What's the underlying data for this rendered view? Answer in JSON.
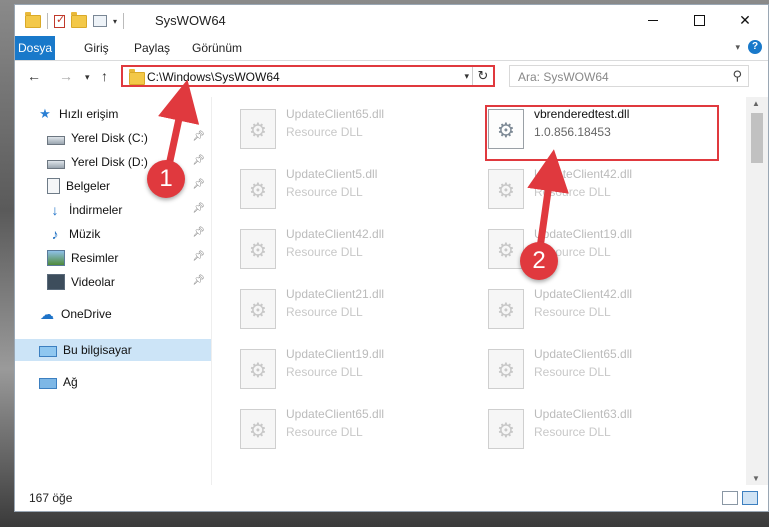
{
  "window": {
    "title": "SysWOW64"
  },
  "ribbon": {
    "tabs": [
      {
        "label": "Dosya",
        "active": true
      },
      {
        "label": "Giriş"
      },
      {
        "label": "Paylaş"
      },
      {
        "label": "Görünüm"
      }
    ]
  },
  "address": {
    "path": "C:\\Windows\\SysWOW64"
  },
  "search": {
    "placeholder": "Ara: SysWOW64"
  },
  "sidebar": {
    "items": [
      {
        "label": "Hızlı erişim",
        "icon": "star-icon"
      },
      {
        "label": "Yerel Disk (C:)",
        "icon": "disk-icon",
        "pinned": true
      },
      {
        "label": "Yerel Disk (D:)",
        "icon": "disk-icon",
        "pinned": true
      },
      {
        "label": "Belgeler",
        "icon": "document-icon",
        "pinned": true
      },
      {
        "label": "İndirmeler",
        "icon": "download-icon",
        "pinned": true
      },
      {
        "label": "Müzik",
        "icon": "music-icon",
        "pinned": true
      },
      {
        "label": "Resimler",
        "icon": "picture-icon",
        "pinned": true
      },
      {
        "label": "Videolar",
        "icon": "video-icon",
        "pinned": true
      },
      {
        "label": "OneDrive",
        "icon": "cloud-icon"
      },
      {
        "label": "Bu bilgisayar",
        "icon": "computer-icon",
        "selected": true
      },
      {
        "label": "Ağ",
        "icon": "network-icon"
      }
    ]
  },
  "files": [
    {
      "name": "UpdateClient65.dll",
      "desc": "Resource DLL"
    },
    {
      "name": "vbrenderedtest.dll",
      "desc": "1.0.856.18453",
      "highlighted": true
    },
    {
      "name": "UpdateClient5.dll",
      "desc": "Resource DLL"
    },
    {
      "name": "UpdateClient42.dll",
      "desc": "Resource DLL"
    },
    {
      "name": "UpdateClient42.dll",
      "desc": "Resource DLL"
    },
    {
      "name": "UpdateClient19.dll",
      "desc": "Resource DLL"
    },
    {
      "name": "UpdateClient21.dll",
      "desc": "Resource DLL"
    },
    {
      "name": "UpdateClient42.dll",
      "desc": "Resource DLL"
    },
    {
      "name": "UpdateClient19.dll",
      "desc": "Resource DLL"
    },
    {
      "name": "UpdateClient65.dll",
      "desc": "Resource DLL"
    },
    {
      "name": "UpdateClient65.dll",
      "desc": "Resource DLL"
    },
    {
      "name": "UpdateClient63.dll",
      "desc": "Resource DLL"
    }
  ],
  "status": {
    "item_count": "167 öğe"
  },
  "annotations": {
    "step1": "1",
    "step2": "2",
    "color": "#e0393e"
  }
}
